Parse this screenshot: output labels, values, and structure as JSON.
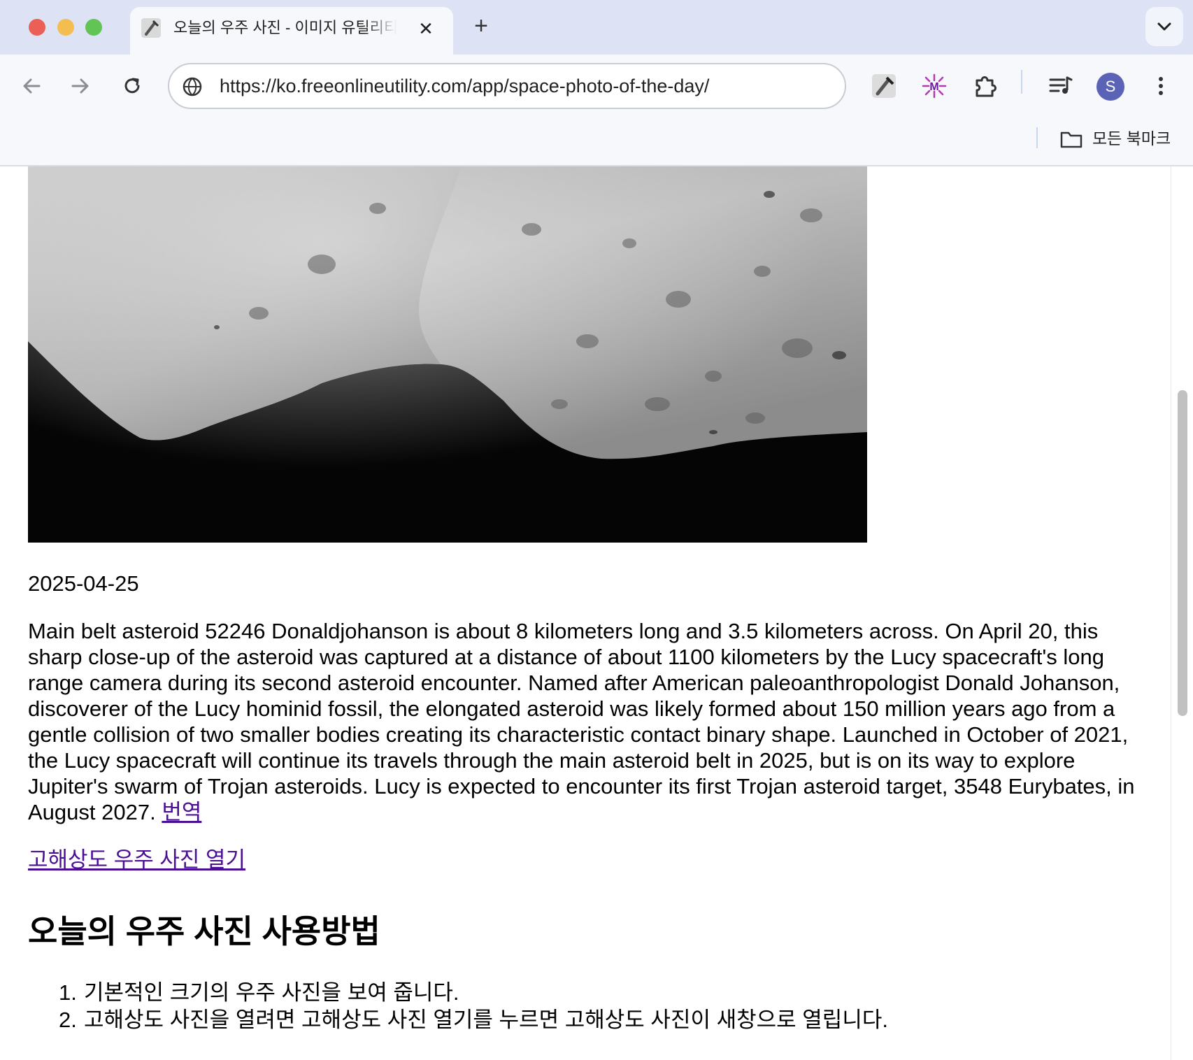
{
  "browser": {
    "tab": {
      "title": "오늘의 우주 사진 - 이미지 유틸리티",
      "close_glyph": "✕"
    },
    "new_tab_glyph": "+",
    "address_bar": {
      "url": "https://ko.freeonlineutility.com/app/space-photo-of-the-day/"
    },
    "profile_initial": "S",
    "bookmarks": {
      "all_bookmarks_label": "모든 북마크"
    },
    "icons": [
      "back-icon",
      "forward-icon",
      "reload-icon",
      "globe-icon",
      "utility-extension-icon",
      "sparkle-extension-icon",
      "extensions-puzzle-icon",
      "media-playlist-icon",
      "more-menu-icon",
      "folder-icon",
      "chevron-down-icon"
    ],
    "colors": {
      "tabstrip": "#dde3f5",
      "toolbar": "#f7f8fc",
      "link": "#4b0f96",
      "avatar": "#5a63b5"
    }
  },
  "page": {
    "photo": {
      "alt": "",
      "description": "grayscale close-up of a cratered asteroid surface against black space"
    },
    "date": "2025-04-25",
    "explanation": "Main belt asteroid 52246 Donaldjohanson is about 8 kilometers long and 3.5 kilometers across. On April 20, this sharp close-up of the asteroid was captured at a distance of about 1100 kilometers by the Lucy spacecraft's long range camera during its second asteroid encounter. Named after American paleoanthropologist Donald Johanson, discoverer of the Lucy hominid fossil, the elongated asteroid was likely formed about 150 million years ago from a gentle collision of two smaller bodies creating its characteristic contact binary shape. Launched in October of 2021, the Lucy spacecraft will continue its travels through the main asteroid belt in 2025, but is on its way to explore Jupiter's swarm of Trojan asteroids. Lucy is expected to encounter its first Trojan asteroid target, 3548 Eurybates, in August 2027.",
    "translate_link": "번역",
    "hires_link": "고해상도 우주 사진 열기",
    "howto": {
      "title": "오늘의 우주 사진 사용방법",
      "steps": [
        {
          "num": "1.",
          "text": "기본적인 크기의 우주 사진을 보여 줍니다."
        },
        {
          "num": "2.",
          "text": "고해상도 사진을 열려면 고해상도 사진 열기를 누르면 고해상도 사진이 새창으로 열립니다."
        }
      ]
    }
  }
}
